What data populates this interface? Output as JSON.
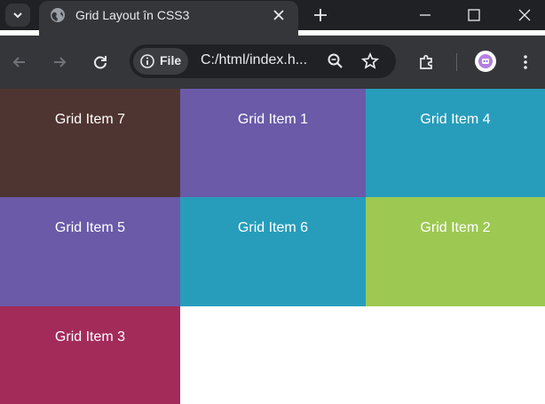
{
  "browser": {
    "tab_title": "Grid Layout în CSS3",
    "site_chip_label": "File",
    "url": "C:/html/index.h..."
  },
  "icons": {
    "tab_search": "chevron-down-icon",
    "favicon": "globe-icon",
    "tab_close": "close-icon",
    "new_tab": "plus-icon",
    "minimize": "minimize-icon",
    "maximize": "maximize-icon",
    "close_window": "close-window-icon",
    "back": "back-arrow-icon",
    "forward": "forward-arrow-icon",
    "reload": "reload-icon",
    "site_info": "info-icon",
    "zoom": "zoom-icon",
    "bookmark": "star-icon",
    "extensions": "puzzle-icon",
    "menu": "more-vert-icon"
  },
  "grid": {
    "items": [
      {
        "label": "Grid Item 7",
        "color": "#4f3531"
      },
      {
        "label": "Grid Item 1",
        "color": "#6a5aa8"
      },
      {
        "label": "Grid Item 4",
        "color": "#279dbb"
      },
      {
        "label": "Grid Item 5",
        "color": "#6a5aa8"
      },
      {
        "label": "Grid Item 6",
        "color": "#279dbb"
      },
      {
        "label": "Grid Item 2",
        "color": "#9dc952"
      },
      {
        "label": "Grid Item 3",
        "color": "#a32b5a"
      }
    ]
  },
  "colors": {
    "chrome_dark": "#202124",
    "chrome_mid": "#35363a",
    "text": "#e8eaed"
  }
}
